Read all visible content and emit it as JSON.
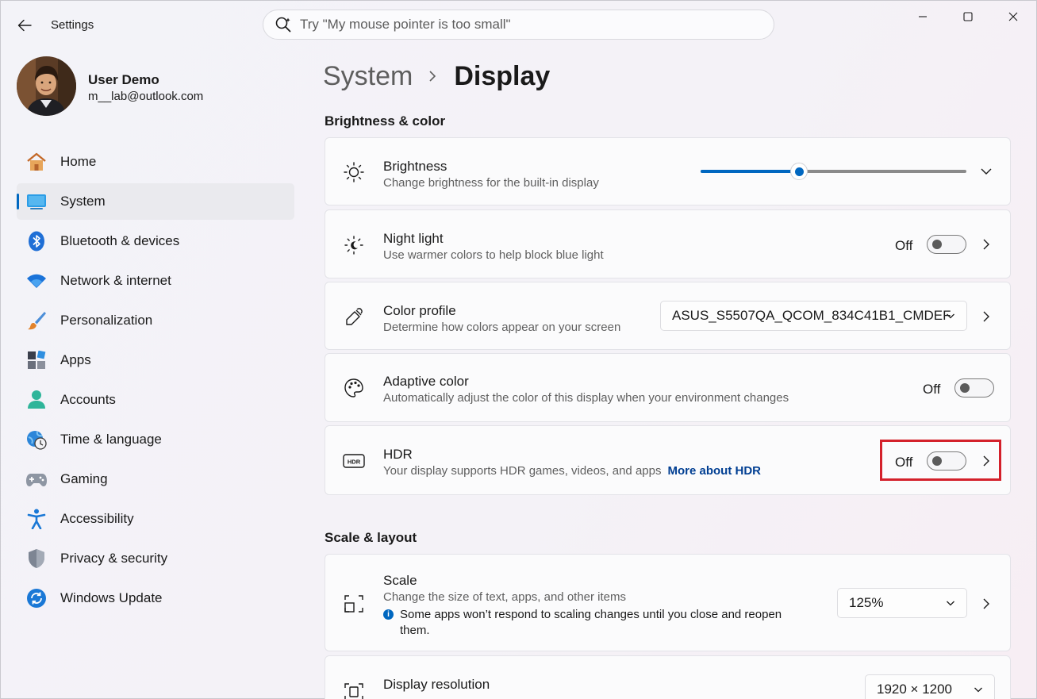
{
  "window": {
    "title": "Settings"
  },
  "search": {
    "placeholder": "Try \"My mouse pointer is too small\""
  },
  "profile": {
    "name": "User Demo",
    "email": "m__lab@outlook.com"
  },
  "sidebar": {
    "items": [
      {
        "label": "Home",
        "icon": "home-icon"
      },
      {
        "label": "System",
        "icon": "system-icon",
        "active": true
      },
      {
        "label": "Bluetooth & devices",
        "icon": "bluetooth-icon"
      },
      {
        "label": "Network & internet",
        "icon": "wifi-icon"
      },
      {
        "label": "Personalization",
        "icon": "brush-icon"
      },
      {
        "label": "Apps",
        "icon": "apps-icon"
      },
      {
        "label": "Accounts",
        "icon": "accounts-icon"
      },
      {
        "label": "Time & language",
        "icon": "globe-clock-icon"
      },
      {
        "label": "Gaming",
        "icon": "gamepad-icon"
      },
      {
        "label": "Accessibility",
        "icon": "accessibility-icon"
      },
      {
        "label": "Privacy & security",
        "icon": "shield-icon"
      },
      {
        "label": "Windows Update",
        "icon": "update-icon"
      }
    ]
  },
  "breadcrumb": {
    "parent": "System",
    "current": "Display"
  },
  "sections": {
    "brightness_color": "Brightness & color",
    "scale_layout": "Scale & layout"
  },
  "brightness": {
    "title": "Brightness",
    "description": "Change brightness for the built-in display",
    "value_fraction": 0.37
  },
  "night_light": {
    "title": "Night light",
    "description": "Use warmer colors to help block blue light",
    "state": "Off"
  },
  "color_profile": {
    "title": "Color profile",
    "description": "Determine how colors appear on your screen",
    "selected": "ASUS_S5507QA_QCOM_834C41B1_CMDEF"
  },
  "adaptive_color": {
    "title": "Adaptive color",
    "description": "Automatically adjust the color of this display when your environment changes",
    "state": "Off"
  },
  "hdr": {
    "title": "HDR",
    "description": "Your display supports HDR games, videos, and apps",
    "link": "More about HDR",
    "state": "Off"
  },
  "scale": {
    "title": "Scale",
    "description": "Change the size of text, apps, and other items",
    "note": "Some apps won’t respond to scaling changes until you close and reopen them.",
    "selected": "125%"
  },
  "display_resolution": {
    "title": "Display resolution",
    "selected": "1920 × 1200"
  },
  "colors": {
    "accent": "#0067c0",
    "highlight_box": "#d4212b"
  }
}
